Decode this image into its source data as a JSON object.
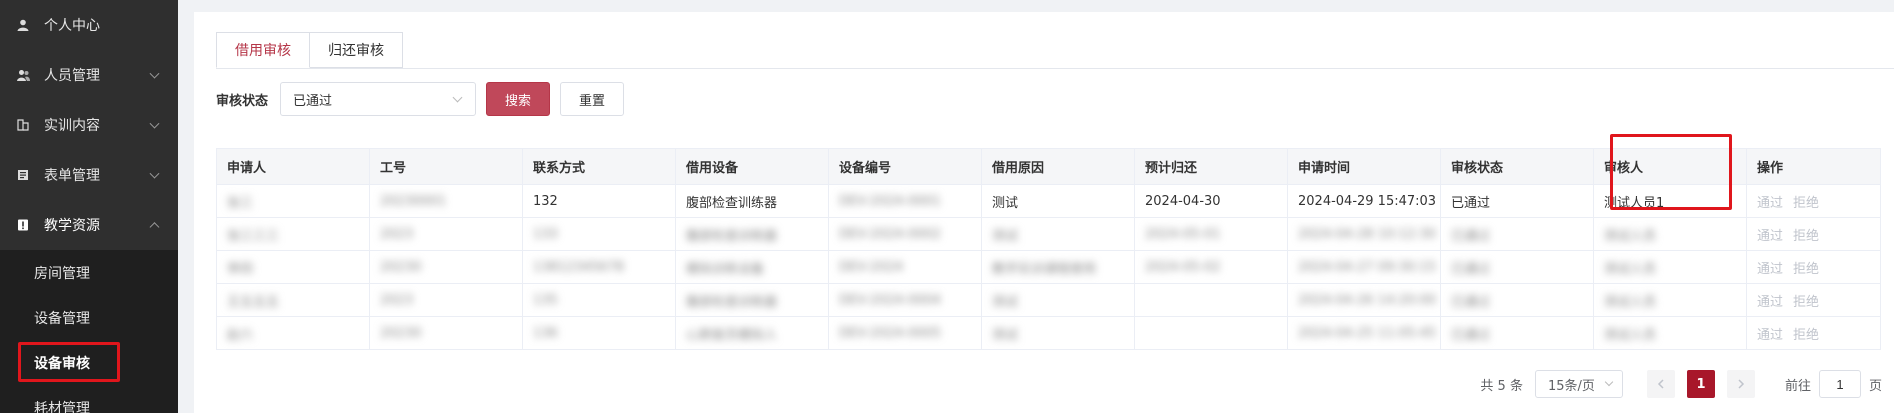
{
  "sidebar": {
    "items": [
      {
        "label": "个人中心",
        "icon": "user-icon"
      },
      {
        "label": "人员管理",
        "icon": "users-icon"
      },
      {
        "label": "实训内容",
        "icon": "book-icon"
      },
      {
        "label": "表单管理",
        "icon": "form-icon"
      },
      {
        "label": "教学资源",
        "icon": "resource-icon"
      }
    ],
    "sub_items": [
      {
        "label": "房间管理"
      },
      {
        "label": "设备管理"
      },
      {
        "label": "设备审核"
      },
      {
        "label": "耗材管理"
      }
    ]
  },
  "tabs": [
    {
      "label": "借用审核"
    },
    {
      "label": "归还审核"
    }
  ],
  "filter": {
    "label": "审核状态",
    "selected": "已通过",
    "search_label": "搜索",
    "reset_label": "重置"
  },
  "table": {
    "columns": [
      "申请人",
      "工号",
      "联系方式",
      "借用设备",
      "设备编号",
      "借用原因",
      "预计归还",
      "申请时间",
      "审核状态",
      "审核人",
      "操作"
    ],
    "first_row": {
      "applicant": "张三",
      "job_no": "20230001",
      "contact": "132",
      "device": "腹部检查训练器",
      "device_no": "DEV-2024-0001",
      "reason": "测试",
      "return_date": "2024-04-30",
      "apply_time": "2024-04-29 15:47:03",
      "status": "已通过",
      "reviewer": "测试人员1"
    },
    "blurred_rows": [
      {
        "applicant": "张三三三",
        "job_no": "2023",
        "contact": "133",
        "device": "腹部检查训练器",
        "device_no": "DEV-2024-0002",
        "reason": "测试",
        "return_date": "2024-05-01",
        "apply_time": "2024-04-28 10:12:30",
        "status": "已通过",
        "reviewer": "测试人员"
      },
      {
        "applicant": "李四",
        "job_no": "20230",
        "contact": "13812345678",
        "device": "模拟训练设备",
        "device_no": "DEV-2024",
        "reason": "教学实训课程使用",
        "return_date": "2024-05-02",
        "apply_time": "2024-04-27 09:30:15",
        "status": "已通过",
        "reviewer": "测试人员"
      },
      {
        "applicant": "王五五五",
        "job_no": "2023",
        "contact": "135",
        "device": "腹部检查训练器",
        "device_no": "DEV-2024-0004",
        "reason": "测试",
        "return_date": "",
        "apply_time": "2024-04-26 14:20:00",
        "status": "已通过",
        "reviewer": "测试人员"
      },
      {
        "applicant": "赵六",
        "job_no": "20230",
        "contact": "136",
        "device": "心肺复苏模拟人",
        "device_no": "DEV-2024-0005",
        "reason": "测试",
        "return_date": "",
        "apply_time": "2024-04-25 11:05:45",
        "status": "已通过",
        "reviewer": "测试人员"
      }
    ],
    "ops": {
      "approve": "通过",
      "reject": "拒绝"
    }
  },
  "pagination": {
    "total": "共 5 条",
    "page_size": "15条/页",
    "current_page": "1",
    "goto_label": "前往",
    "goto_value": "1",
    "page_suffix": "页"
  },
  "colors": {
    "accent": "#b53648",
    "active_page": "#a8172a",
    "sidebar_bg": "#2f2f2f",
    "highlight": "#e0161c"
  }
}
